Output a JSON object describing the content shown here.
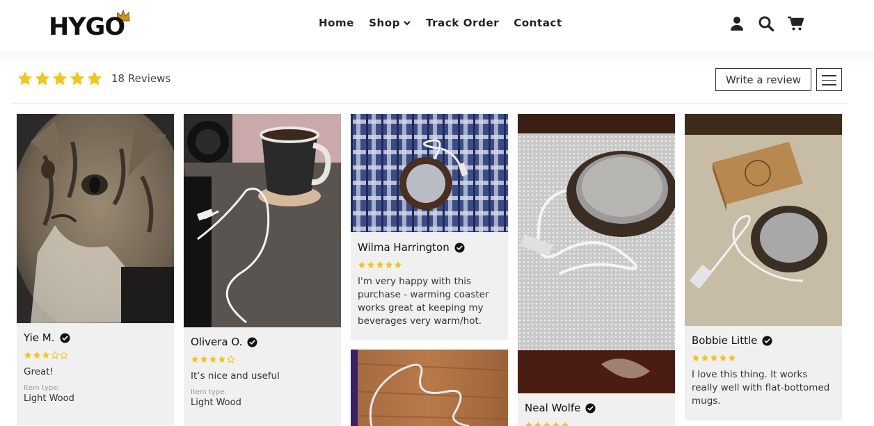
{
  "brand": {
    "name": "HYGO",
    "crown_color": "#c9951b"
  },
  "nav": {
    "items": [
      {
        "label": "Home"
      },
      {
        "label": "Shop"
      },
      {
        "label": "Track Order"
      },
      {
        "label": "Contact"
      }
    ]
  },
  "header_icons": [
    "user-icon",
    "search-icon",
    "cart-icon"
  ],
  "reviews_summary": {
    "rating": 5,
    "count_label": "18 Reviews",
    "write_review_label": "Write a review",
    "star_color": "#f5c518"
  },
  "reviews": [
    {
      "name": "Yie M.",
      "rating": 3,
      "text": "Great!",
      "item_type_label": "Item type:",
      "item_type": "Light Wood"
    },
    {
      "name": "Olivera O.",
      "rating": 4,
      "text": "It’s nice and useful",
      "item_type_label": "Item type:",
      "item_type": "Light Wood"
    },
    {
      "name": "Wilma Harrington",
      "rating": 5,
      "text": "I'm very happy with this purchase - warming coaster works great at keeping my beverages very warm/hot."
    },
    {
      "name": "Neal Wolfe",
      "rating": 5
    },
    {
      "name": "Bobbie Little",
      "rating": 5,
      "text": "I love this thing. It works really well with flat-bottomed mugs."
    }
  ]
}
